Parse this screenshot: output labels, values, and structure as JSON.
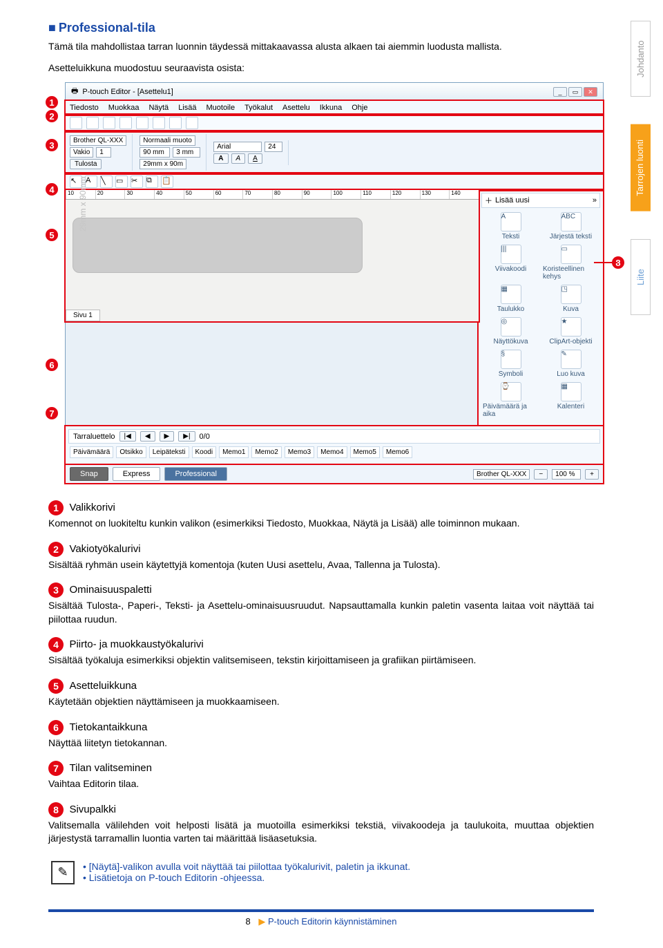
{
  "section_title": "Professional-tila",
  "intro_1": "Tämä tila mahdollistaa tarran luonnin täydessä mittakaavassa alusta alkaen tai aiemmin luodusta mallista.",
  "intro_2": "Asetteluikkuna muodostuu seuraavista osista:",
  "side_tabs": {
    "a": "Johdanto",
    "b": "Tarrojen luonti",
    "c": "Liite"
  },
  "app": {
    "title": "P-touch Editor - [Asettelu1]",
    "menu": [
      "Tiedosto",
      "Muokkaa",
      "Näytä",
      "Lisää",
      "Muotoile",
      "Työkalut",
      "Asettelu",
      "Ikkuna",
      "Ohje"
    ],
    "printer": "Brother QL-XXX",
    "media": "Vakio",
    "qty": "1",
    "print_btn": "Tulosta",
    "mode_label": "Normaali muoto",
    "width": "90 mm",
    "height": "3 mm",
    "size_combo": "29mm x 90m",
    "font": "Arial",
    "font_size": "24",
    "sidebar_title": "Lisää uusi",
    "sidebar_items": [
      {
        "icon": "A",
        "label": "Teksti"
      },
      {
        "icon": "ABC",
        "label": "Järjestä teksti"
      },
      {
        "icon": "|||",
        "label": "Viivakoodi"
      },
      {
        "icon": "▭",
        "label": "Koristeellinen kehys"
      },
      {
        "icon": "▦",
        "label": "Taulukko"
      },
      {
        "icon": "◳",
        "label": "Kuva"
      },
      {
        "icon": "◎",
        "label": "Näyttökuva"
      },
      {
        "icon": "★",
        "label": "ClipArt-objekti"
      },
      {
        "icon": "§",
        "label": "Symboli"
      },
      {
        "icon": "✎",
        "label": "Luo kuva"
      },
      {
        "icon": "⌚",
        "label": "Päivämäärä ja aika"
      },
      {
        "icon": "▦",
        "label": "Kalenteri"
      }
    ],
    "canvas_size": "29mm x 90mm",
    "page_tab": "Sivu 1",
    "db_title": "Tarraluettelo",
    "db_pager": "0/0",
    "db_fields": [
      "Päivämäärä",
      "Otsikko",
      "Leipäteksti",
      "Koodi",
      "Memo1",
      "Memo2",
      "Memo3",
      "Memo4",
      "Memo5",
      "Memo6"
    ],
    "mode_snap": "Snap",
    "mode_express": "Express",
    "mode_pro": "Professional",
    "status_printer": "Brother QL-XXX",
    "zoom": "100 %"
  },
  "callouts": {
    "1": "1",
    "2": "2",
    "3": "3",
    "4": "4",
    "5": "5",
    "6": "6",
    "7": "7",
    "8": "8"
  },
  "items": [
    {
      "n": "1",
      "title": "Valikkorivi",
      "text": "Komennot on luokiteltu kunkin valikon (esimerkiksi Tiedosto, Muokkaa, Näytä ja Lisää) alle toiminnon mukaan."
    },
    {
      "n": "2",
      "title": "Vakiotyökalurivi",
      "text": "Sisältää ryhmän usein käytettyjä komentoja (kuten Uusi asettelu, Avaa, Tallenna ja Tulosta)."
    },
    {
      "n": "3",
      "title": "Ominaisuuspaletti",
      "text": "Sisältää Tulosta-, Paperi-, Teksti- ja Asettelu-ominaisuusruudut. Napsauttamalla kunkin paletin vasenta laitaa voit näyttää tai piilottaa ruudun."
    },
    {
      "n": "4",
      "title": "Piirto- ja muokkaustyökalurivi",
      "text": "Sisältää työkaluja esimerkiksi objektin valitsemiseen, tekstin kirjoittamiseen ja grafiikan piirtämiseen."
    },
    {
      "n": "5",
      "title": "Asetteluikkuna",
      "text": "Käytetään objektien näyttämiseen ja muokkaamiseen."
    },
    {
      "n": "6",
      "title": "Tietokantaikkuna",
      "text": "Näyttää liitetyn tietokannan."
    },
    {
      "n": "7",
      "title": "Tilan valitseminen",
      "text": "Vaihtaa Editorin tilaa."
    },
    {
      "n": "8",
      "title": "Sivupalkki",
      "text": "Valitsemalla välilehden voit helposti lisätä ja muotoilla esimerkiksi tekstiä, viivakoodeja ja taulukoita, muuttaa objektien järjestystä tarramallin luontia varten tai määrittää lisäasetuksia."
    }
  ],
  "notes": [
    "[Näytä]-valikon avulla voit näyttää tai piilottaa työkalurivit, paletin ja ikkunat.",
    "Lisätietoja on P-touch Editorin -ohjeessa."
  ],
  "page_number": "8",
  "footer_crumb": "P-touch Editorin käynnistäminen"
}
